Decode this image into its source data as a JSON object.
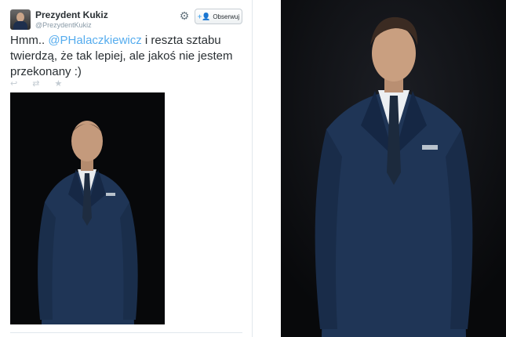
{
  "tweet": {
    "author_name": "Prezydent Kukiz",
    "author_handle": "@PrezydentKukiz",
    "follow_label": "Obserwuj",
    "text_before": "Hmm.. ",
    "mention": "@PHalaczkiewicz",
    "text_after": " i reszta sztabu twierdzą, że tak lepiej, ale jakoś nie jestem przekonany :)",
    "icons": {
      "settings": "gear-icon",
      "follow": "follow-user-icon",
      "reply": "reply-icon",
      "retweet": "retweet-icon",
      "favorite": "star-icon"
    }
  },
  "colors": {
    "link": "#55acee",
    "text": "#292f33",
    "muted": "#8899a6",
    "suit": "#1f3556",
    "background_photo": "#0b0c0f"
  }
}
